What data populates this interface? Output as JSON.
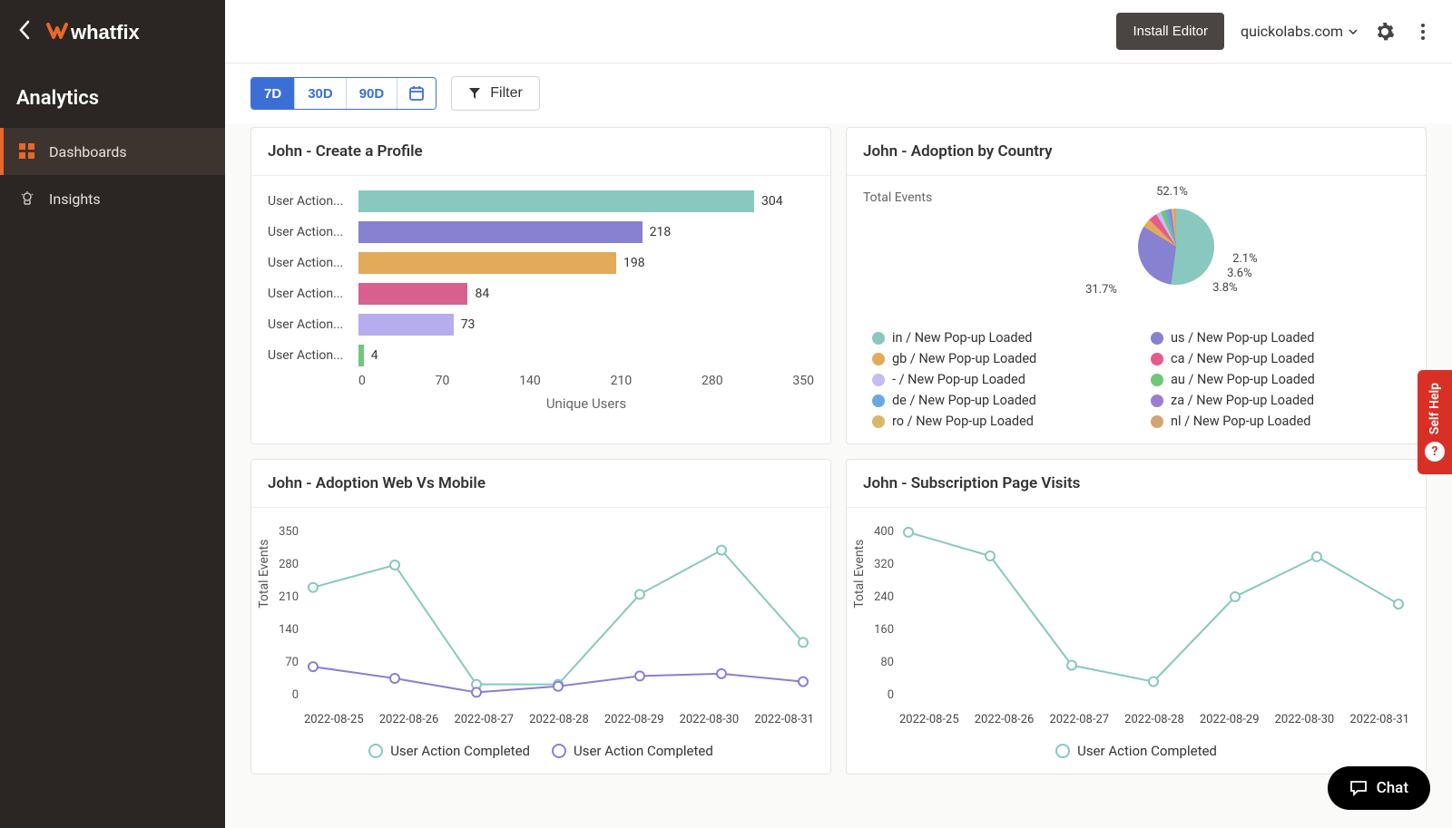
{
  "brand": "whatfix",
  "sidebar": {
    "title": "Analytics",
    "items": [
      {
        "label": "Dashboards",
        "active": true
      },
      {
        "label": "Insights",
        "active": false
      }
    ]
  },
  "topbar": {
    "install_label": "Install Editor",
    "domain": "quickolabs.com"
  },
  "toolbar": {
    "ranges": [
      "7D",
      "30D",
      "90D"
    ],
    "active_range": "7D",
    "filter_label": "Filter"
  },
  "cards": {
    "bar": {
      "title": "John - Create a Profile",
      "xlabel": "Unique Users"
    },
    "pie": {
      "title": "John - Adoption by Country",
      "ylabel": "Total Events"
    },
    "line1": {
      "title": "John - Adoption Web Vs Mobile",
      "ylabel": "Total Events"
    },
    "line2": {
      "title": "John - Subscription Page Visits",
      "ylabel": "Total Events"
    }
  },
  "self_help_label": "Self Help",
  "chat_label": "Chat",
  "chart_data": [
    {
      "id": "bar",
      "type": "bar",
      "categories": [
        "User Action...",
        "User Action...",
        "User Action...",
        "User Action...",
        "User Action...",
        "User Action..."
      ],
      "values": [
        304,
        218,
        198,
        84,
        73,
        4
      ],
      "colors": [
        "#88c8be",
        "#8880d0",
        "#e3aa5a",
        "#d8608e",
        "#b6adec",
        "#6fc87a"
      ],
      "xlabel": "Unique Users",
      "xticks": [
        0,
        70,
        140,
        210,
        280,
        350
      ],
      "xlim": [
        0,
        350
      ]
    },
    {
      "id": "pie",
      "type": "pie",
      "series": [
        {
          "name": "in / New Pop-up Loaded",
          "value": 52.1,
          "color": "#88c8be"
        },
        {
          "name": "us / New Pop-up Loaded",
          "value": 31.7,
          "color": "#8880d0"
        },
        {
          "name": "gb / New Pop-up Loaded",
          "value": 3.8,
          "color": "#e3aa5a"
        },
        {
          "name": "ca / New Pop-up Loaded",
          "value": 3.6,
          "color": "#e75a8a"
        },
        {
          "name": "- / New Pop-up Loaded",
          "value": 2.1,
          "color": "#c6bbf2"
        },
        {
          "name": "au / New Pop-up Loaded",
          "value": 2.0,
          "color": "#6fc87a"
        },
        {
          "name": "de / New Pop-up Loaded",
          "value": 1.5,
          "color": "#6aa8e4"
        },
        {
          "name": "za / New Pop-up Loaded",
          "value": 1.2,
          "color": "#9a7cd4"
        },
        {
          "name": "ro / New Pop-up Loaded",
          "value": 1.0,
          "color": "#d9b76a"
        },
        {
          "name": "nl / New Pop-up Loaded",
          "value": 1.0,
          "color": "#d2a574"
        }
      ],
      "visible_labels": [
        "52.1%",
        "31.7%",
        "3.8%",
        "3.6%",
        "2.1%"
      ]
    },
    {
      "id": "line1",
      "type": "line",
      "x": [
        "2022-08-25",
        "2022-08-26",
        "2022-08-27",
        "2022-08-28",
        "2022-08-29",
        "2022-08-30",
        "2022-08-31"
      ],
      "series": [
        {
          "name": "User Action Completed",
          "color": "#88c8be",
          "values": [
            230,
            278,
            22,
            22,
            215,
            310,
            112
          ]
        },
        {
          "name": "User Action Completed",
          "color": "#8880d0",
          "values": [
            60,
            35,
            5,
            18,
            40,
            45,
            28
          ]
        }
      ],
      "yticks": [
        0,
        70,
        140,
        210,
        280,
        350
      ],
      "ylim": [
        0,
        350
      ],
      "ylabel": "Total Events"
    },
    {
      "id": "line2",
      "type": "line",
      "x": [
        "2022-08-25",
        "2022-08-26",
        "2022-08-27",
        "2022-08-28",
        "2022-08-29",
        "2022-08-30",
        "2022-08-31"
      ],
      "series": [
        {
          "name": "User Action Completed",
          "color": "#88c8be",
          "values": [
            398,
            340,
            72,
            32,
            240,
            338,
            222
          ]
        }
      ],
      "yticks": [
        0,
        80,
        160,
        240,
        320,
        400
      ],
      "ylim": [
        0,
        400
      ],
      "ylabel": "Total Events"
    }
  ]
}
